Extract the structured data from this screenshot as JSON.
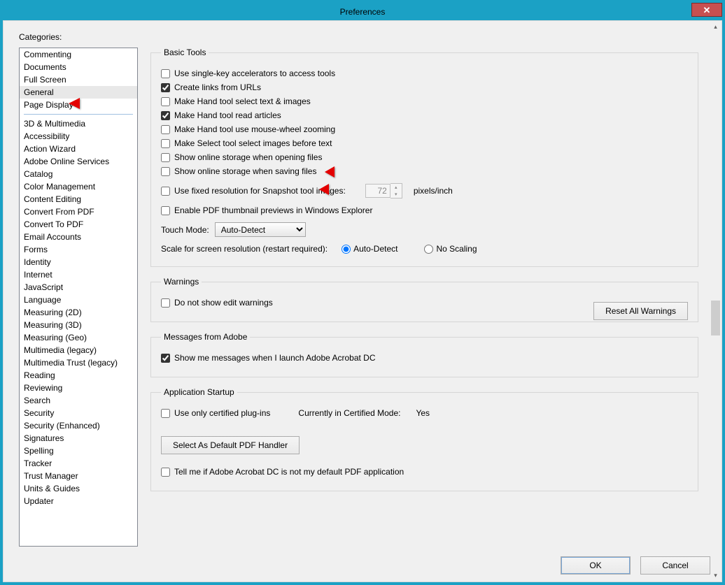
{
  "window": {
    "title": "Preferences"
  },
  "sidebar": {
    "label": "Categories:",
    "group1": [
      {
        "label": "Commenting"
      },
      {
        "label": "Documents"
      },
      {
        "label": "Full Screen"
      },
      {
        "label": "General",
        "selected": true
      },
      {
        "label": "Page Display"
      }
    ],
    "group2": [
      {
        "label": "3D & Multimedia"
      },
      {
        "label": "Accessibility"
      },
      {
        "label": "Action Wizard"
      },
      {
        "label": "Adobe Online Services"
      },
      {
        "label": "Catalog"
      },
      {
        "label": "Color Management"
      },
      {
        "label": "Content Editing"
      },
      {
        "label": "Convert From PDF"
      },
      {
        "label": "Convert To PDF"
      },
      {
        "label": "Email Accounts"
      },
      {
        "label": "Forms"
      },
      {
        "label": "Identity"
      },
      {
        "label": "Internet"
      },
      {
        "label": "JavaScript"
      },
      {
        "label": "Language"
      },
      {
        "label": "Measuring (2D)"
      },
      {
        "label": "Measuring (3D)"
      },
      {
        "label": "Measuring (Geo)"
      },
      {
        "label": "Multimedia (legacy)"
      },
      {
        "label": "Multimedia Trust (legacy)"
      },
      {
        "label": "Reading"
      },
      {
        "label": "Reviewing"
      },
      {
        "label": "Search"
      },
      {
        "label": "Security"
      },
      {
        "label": "Security (Enhanced)"
      },
      {
        "label": "Signatures"
      },
      {
        "label": "Spelling"
      },
      {
        "label": "Tracker"
      },
      {
        "label": "Trust Manager"
      },
      {
        "label": "Units & Guides"
      },
      {
        "label": "Updater"
      }
    ]
  },
  "groups": {
    "basic_tools": {
      "legend": "Basic Tools",
      "opts": {
        "single_key": {
          "label": "Use single-key accelerators to access tools",
          "checked": false
        },
        "create_links": {
          "label": "Create links from URLs",
          "checked": true
        },
        "hand_select_text": {
          "label": "Make Hand tool select text & images",
          "checked": false
        },
        "hand_read_articles": {
          "label": "Make Hand tool read articles",
          "checked": true
        },
        "hand_mouse_wheel": {
          "label": "Make Hand tool use mouse-wheel zooming",
          "checked": false
        },
        "select_images_before": {
          "label": "Make Select tool select images before text",
          "checked": false
        },
        "online_open": {
          "label": "Show online storage when opening files",
          "checked": false
        },
        "online_save": {
          "label": "Show online storage when saving files",
          "checked": false
        },
        "fixed_res": {
          "label": "Use fixed resolution for Snapshot tool images:",
          "checked": false,
          "value": "72",
          "unit": "pixels/inch"
        },
        "thumb_preview": {
          "label": "Enable PDF thumbnail previews in Windows Explorer",
          "checked": false
        }
      },
      "touch_mode": {
        "label": "Touch Mode:",
        "value": "Auto-Detect"
      },
      "scale": {
        "label": "Scale for screen resolution (restart required):",
        "auto": "Auto-Detect",
        "none": "No Scaling",
        "selected": "auto"
      }
    },
    "warnings": {
      "legend": "Warnings",
      "no_edit_warn": {
        "label": "Do not show edit warnings",
        "checked": false
      },
      "reset_btn": "Reset All Warnings"
    },
    "messages": {
      "legend": "Messages from Adobe",
      "show_launch": {
        "label": "Show me messages when I launch Adobe Acrobat DC",
        "checked": true
      }
    },
    "startup": {
      "legend": "Application Startup",
      "certified": {
        "label": "Use only certified plug-ins",
        "checked": false
      },
      "cert_mode_label": "Currently in Certified Mode:",
      "cert_mode_value": "Yes",
      "default_handler_btn": "Select As Default PDF Handler",
      "tell_me": {
        "label": "Tell me if Adobe Acrobat DC is not my default PDF application",
        "checked": false
      }
    }
  },
  "footer": {
    "ok": "OK",
    "cancel": "Cancel"
  }
}
